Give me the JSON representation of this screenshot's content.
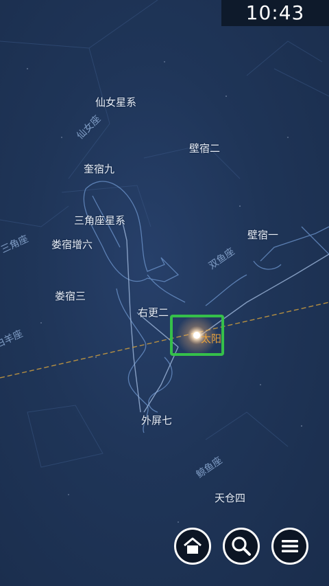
{
  "status_bar": {
    "time": "10:43"
  },
  "stars": {
    "andromeda_galaxy": "仙女星系",
    "kui_9": "奎宿九",
    "triangulum_galaxy": "三角座星系",
    "lou_zeng_6": "娄宿增六",
    "lou_3": "娄宿三",
    "you_geng_2": "右更二",
    "bi_2": "壁宿二",
    "bi_1": "壁宿一",
    "wai_ping_7": "外屏七",
    "tian_cang_4": "天仓四"
  },
  "constellations": {
    "andromeda": "仙女座",
    "triangulum": "三角座",
    "aries": "白羊座",
    "pisces": "双鱼座",
    "cetus": "鲸鱼座"
  },
  "sun": {
    "label": "太阳"
  },
  "toolbar": {
    "buttons": [
      {
        "name": "home",
        "icon": "home-icon"
      },
      {
        "name": "search",
        "icon": "search-icon"
      },
      {
        "name": "menu",
        "icon": "menu-icon"
      }
    ]
  },
  "colors": {
    "sky": "#1f3558",
    "highlight": "#35c04a",
    "sun_label": "#e8a23c",
    "ecliptic": "#c79a3f"
  }
}
